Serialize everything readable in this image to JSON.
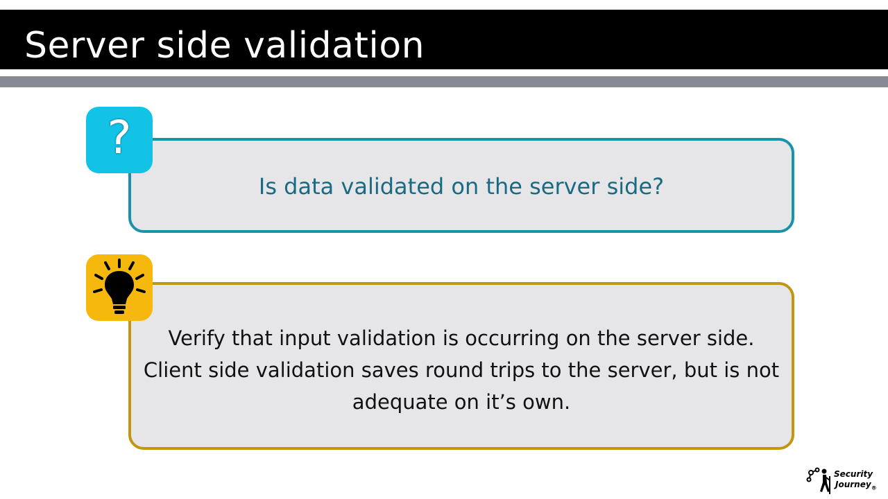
{
  "slide": {
    "title": "Server side validation"
  },
  "question": {
    "icon": "question-mark-icon",
    "icon_color": "#12c3e6",
    "border_color": "#1a93aa",
    "text": "Is data validated on the server side?"
  },
  "answer": {
    "icon": "lightbulb-icon",
    "icon_color": "#f6b80d",
    "border_color": "#c09710",
    "lines": [
      "Verify that input validation is occurring on the server side.",
      "Client side validation saves round trips to the server, but is not",
      "adequate on it’s own."
    ]
  },
  "logo": {
    "icon": "hiker-icon",
    "line1": "Security",
    "line2": "Journey",
    "mark": "®"
  }
}
